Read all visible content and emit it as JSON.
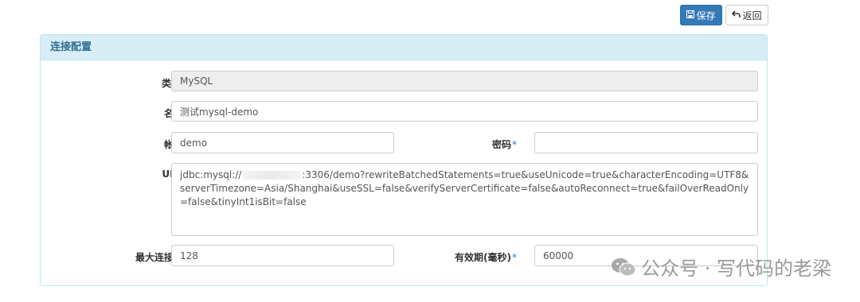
{
  "toolbar": {
    "save_label": "保存",
    "back_label": "返回"
  },
  "panel": {
    "title": "连接配置"
  },
  "form": {
    "type_label": "类型",
    "type_value": "MySQL",
    "name_label": "名称",
    "name_value": "测试mysql-demo",
    "account_label": "帐号",
    "account_value": "demo",
    "password_label": "密码",
    "password_value": "",
    "url_label": "URL",
    "url_prefix": "jdbc:mysql://",
    "url_suffix": ":3306/demo?rewriteBatchedStatements=true&useUnicode=true&characterEncoding=UTF8&serverTimezone=Asia/Shanghai&useSSL=false&verifyServerCertificate=false&autoReconnect=true&failOverReadOnly=false&tinyInt1isBit=false",
    "max_conn_label": "最大连接数",
    "max_conn_value": "128",
    "validity_label": "有效期(毫秒)",
    "validity_value": "60000",
    "required_mark": "*"
  },
  "watermark": {
    "text": "公众号 · 写代码的老梁"
  },
  "colors": {
    "primary": "#337ab7",
    "panel_heading_bg": "#d9edf7",
    "panel_border": "#bce8f1",
    "readonly_bg": "#eeeeee"
  },
  "icons": {
    "save": "floppy-disk-icon",
    "back": "back-arrow-icon",
    "watermark": "wechat-icon"
  }
}
